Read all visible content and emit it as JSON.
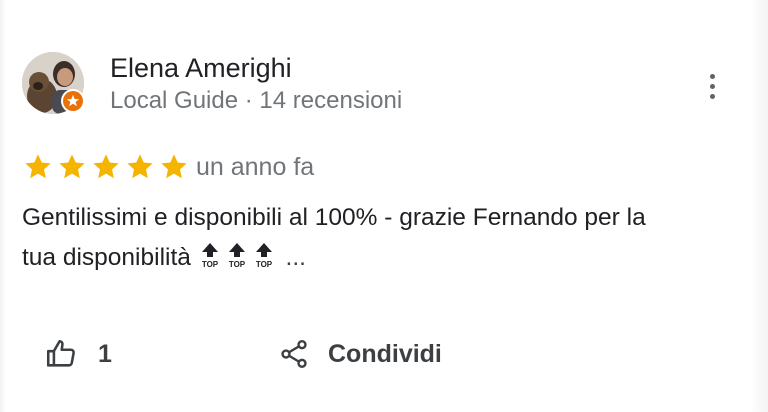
{
  "review": {
    "author": {
      "name": "Elena Amerighi",
      "meta": "Local Guide · 14 recensioni",
      "avatar_icon": "avatar-photo",
      "badge_icon": "local-guide-star-badge",
      "badge_color": "#e8710a"
    },
    "rating": {
      "stars": 5,
      "max": 5,
      "color": "#f4b400"
    },
    "time": "un anno fa",
    "text_line1": "Gentilissimi e disponibili al 100% - grazie Fernando per la",
    "text_line2": "tua disponibilità",
    "emoji_icon": "top-arrow-emoji",
    "emoji_label": "TOP",
    "emoji_count": 3,
    "truncation": "..."
  },
  "actions": {
    "like_icon": "thumbs-up-icon",
    "like_count": "1",
    "share_icon": "share-icon",
    "share_label": "Condividi",
    "more_icon": "more-vert-icon"
  }
}
